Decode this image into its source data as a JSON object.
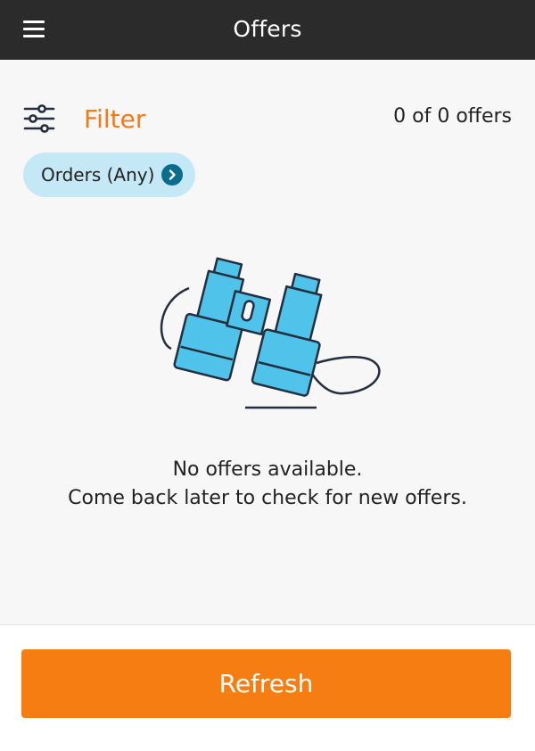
{
  "header": {
    "title": "Offers",
    "menu_icon": "hamburger-menu-icon",
    "background": "#2b2b2b"
  },
  "filter": {
    "icon": "sliders-icon",
    "label": "Filter",
    "label_color": "#f27a1a",
    "offer_count_text": "0 of 0 offers"
  },
  "orders_chip": {
    "label": "Orders (Any)",
    "icon": "chevron-right-circle-icon",
    "background": "#c5e8f6"
  },
  "empty_state": {
    "illustration": "binoculars-icon",
    "line1": "No offers available.",
    "line2": "Come back later to check for new offers."
  },
  "footer": {
    "refresh_label": "Refresh",
    "button_color": "#f57d12"
  }
}
